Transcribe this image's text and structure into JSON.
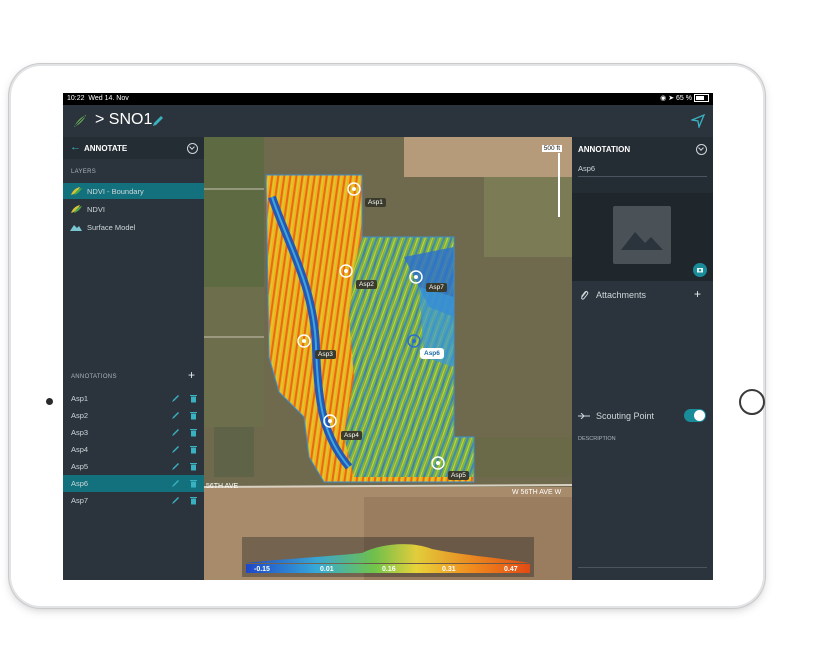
{
  "status": {
    "time": "10:22",
    "date": "Wed 14. Nov",
    "battery": "65 %"
  },
  "nav": {
    "title": "> SNO1"
  },
  "left": {
    "header": "ANNOTATE",
    "layers_label": "LAYERS",
    "layers": [
      {
        "label": "NDVI - Boundary",
        "selected": true,
        "icon": "ndvi-icon"
      },
      {
        "label": "NDVI",
        "selected": false,
        "icon": "ndvi-icon"
      },
      {
        "label": "Surface Model",
        "selected": false,
        "icon": "surface-model-icon"
      }
    ],
    "annotations_label": "ANNOTATIONS",
    "annotations": [
      {
        "label": "Asp1",
        "selected": false
      },
      {
        "label": "Asp2",
        "selected": false
      },
      {
        "label": "Asp3",
        "selected": false
      },
      {
        "label": "Asp4",
        "selected": false
      },
      {
        "label": "Asp5",
        "selected": false
      },
      {
        "label": "Asp6",
        "selected": true
      },
      {
        "label": "Asp7",
        "selected": false
      }
    ]
  },
  "map": {
    "scale_label": "500 ft",
    "road_left": "56TH AVE",
    "road_right": "W 56TH AVE W",
    "pins": [
      {
        "label": "Asp1"
      },
      {
        "label": "Asp2"
      },
      {
        "label": "Asp3"
      },
      {
        "label": "Asp4"
      },
      {
        "label": "Asp5"
      },
      {
        "label": "Asp6",
        "selected": true
      },
      {
        "label": "Asp7"
      }
    ],
    "legend_ticks": [
      "-0.15",
      "0.01",
      "0.16",
      "0.31",
      "0.47"
    ]
  },
  "right": {
    "header": "ANNOTATION",
    "name": "Asp6",
    "attachments_label": "Attachments",
    "scouting_label": "Scouting Point",
    "scouting_on": true,
    "description_label": "DESCRIPTION"
  },
  "colors": {
    "accent": "#1a8c99",
    "selected_row": "#12717c",
    "panel": "#2b343c"
  }
}
